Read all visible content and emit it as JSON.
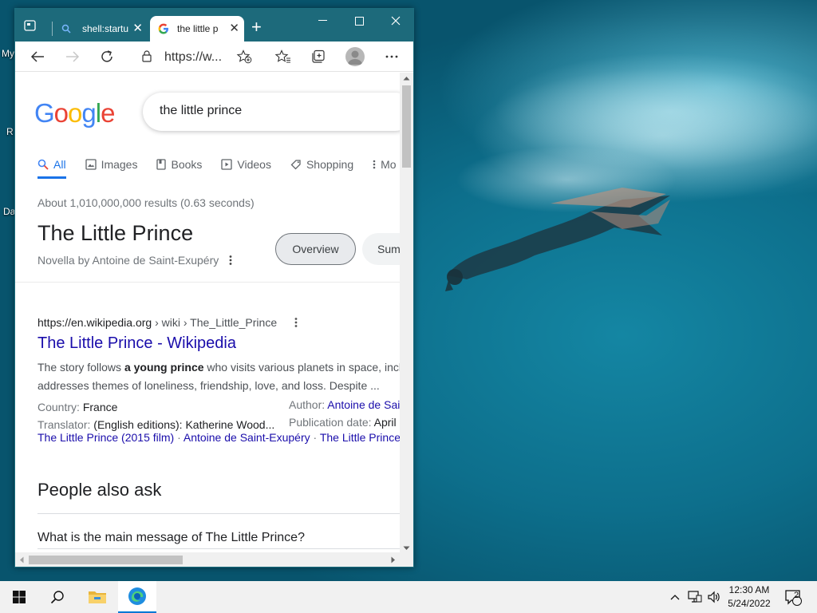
{
  "desktop": {
    "icon_labels": [
      "My",
      "R",
      "Da"
    ]
  },
  "browser": {
    "tabs": [
      {
        "title": "shell:startu",
        "active": false
      },
      {
        "title": "the little p",
        "active": true
      }
    ],
    "address": "https://w...",
    "accent": "#1d6a7b"
  },
  "google": {
    "query": "the little prince",
    "tabs": [
      "All",
      "Images",
      "Books",
      "Videos",
      "Shopping",
      "Mo"
    ],
    "stats": "About 1,010,000,000 results (0.63 seconds)",
    "kp": {
      "title": "The Little Prince",
      "subtitle": "Novella by Antoine de Saint-Exupéry",
      "chips": [
        "Overview",
        "Sum"
      ]
    },
    "result": {
      "url_host": "https://en.wikipedia.org",
      "url_path": " › wiki › The_Little_Prince",
      "title": "The Little Prince - Wikipedia",
      "snippet_1a": "The story follows ",
      "snippet_1b": "a young prince",
      "snippet_1c": " who visits various planets in space, inclu",
      "snippet_2": "addresses themes of loneliness, friendship, love, and loss. Despite ...",
      "facts": {
        "country_label": "Country: ",
        "country_value": "France",
        "translator_label": "Translator: ",
        "translator_value": "(English editions): Katherine Wood...",
        "author_label": "Author: ",
        "author_value": "Antoine de Sai",
        "pubdate_label": "Publication date: ",
        "pubdate_value": "April"
      },
      "sitelinks": [
        "The Little Prince (2015 film)",
        "Antoine de Saint-Exupéry",
        "The Little Prince"
      ],
      "sitelink_sep": " · "
    },
    "paa": {
      "title": "People also ask",
      "questions": [
        "What is the main message of The Little Prince?"
      ]
    }
  },
  "taskbar": {
    "time": "12:30 AM",
    "date": "5/24/2022",
    "notifications": "2"
  }
}
